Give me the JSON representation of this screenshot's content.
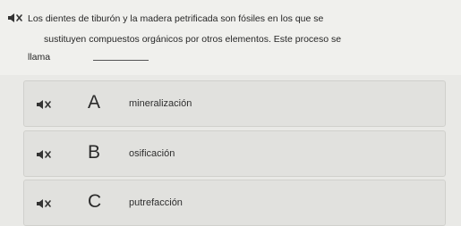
{
  "question": {
    "speaker_icon": "speaker-icon",
    "line1": "Los dientes de tiburón y la madera petrificada son fósiles en los que se",
    "line2": "sustituyen compuestos orgánicos por otros elementos. Este proceso se",
    "line3": "llama"
  },
  "options": [
    {
      "letter": "A",
      "text": "mineralización",
      "speaker_icon": "speaker-icon"
    },
    {
      "letter": "B",
      "text": "osificación",
      "speaker_icon": "speaker-icon"
    },
    {
      "letter": "C",
      "text": "putrefacción",
      "speaker_icon": "speaker-icon"
    }
  ]
}
